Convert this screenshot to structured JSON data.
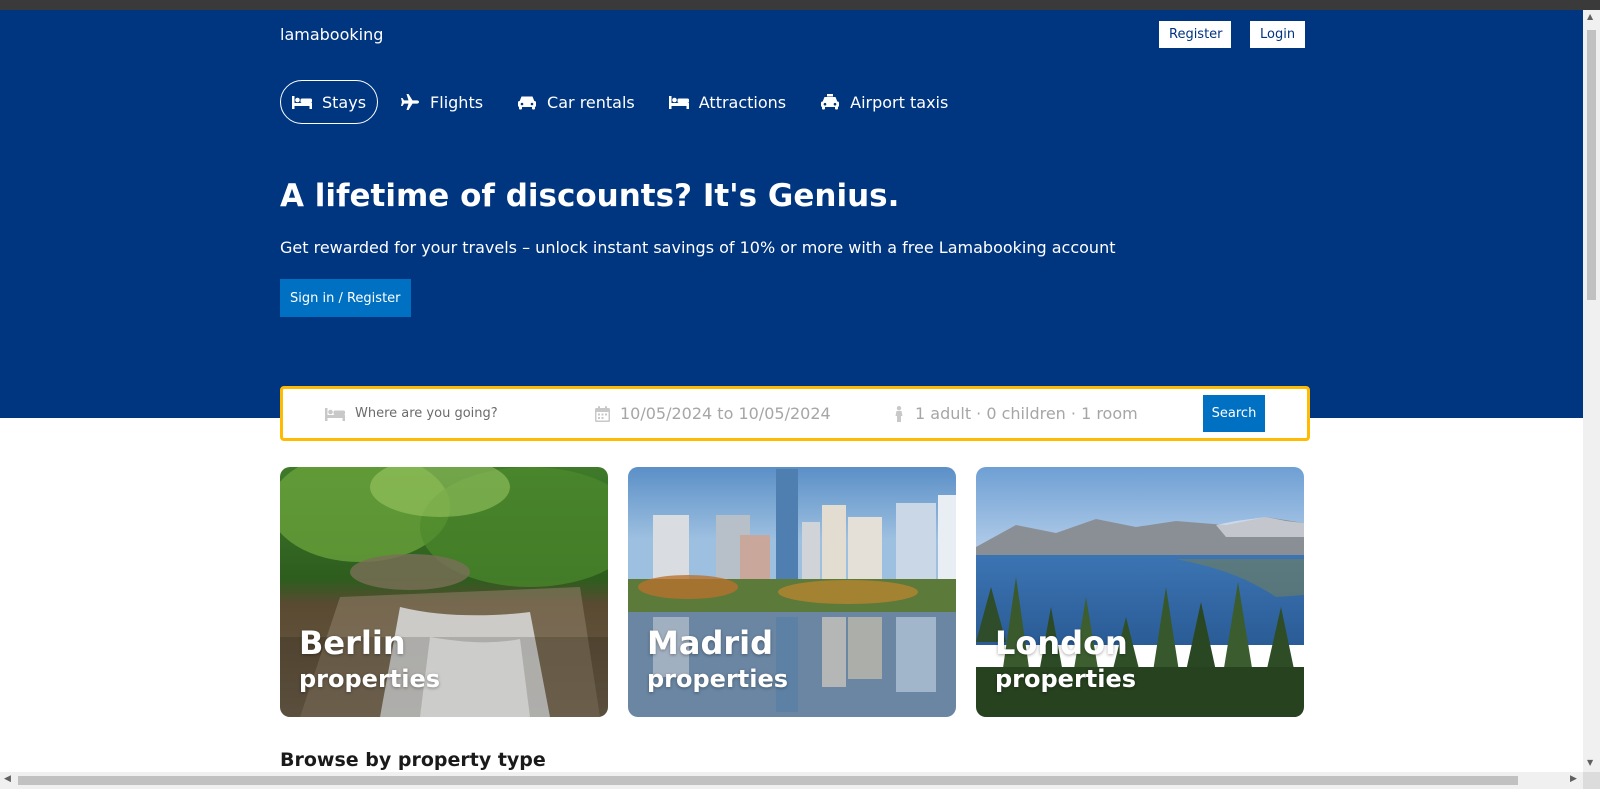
{
  "app": {
    "logo": "lamabooking"
  },
  "auth": {
    "register_label": "Register",
    "login_label": "Login"
  },
  "tabs": [
    {
      "label": "Stays",
      "icon": "bed-icon",
      "active": true
    },
    {
      "label": "Flights",
      "icon": "plane-icon",
      "active": false
    },
    {
      "label": "Car rentals",
      "icon": "car-icon",
      "active": false
    },
    {
      "label": "Attractions",
      "icon": "bed-icon",
      "active": false
    },
    {
      "label": "Airport taxis",
      "icon": "taxi-icon",
      "active": false
    }
  ],
  "hero": {
    "title": "A lifetime of discounts? It's Genius.",
    "subtitle": "Get rewarded for your travels – unlock instant savings of 10% or more with a free Lamabooking account",
    "cta_label": "Sign in / Register"
  },
  "search": {
    "destination_placeholder": "Where are you going?",
    "date_range": "10/05/2024 to 10/05/2024",
    "options": "1 adult · 0 children · 1 room",
    "button_label": "Search"
  },
  "featured": [
    {
      "city": "Berlin",
      "subtitle": "properties",
      "image": "waterfall-forest"
    },
    {
      "city": "Madrid",
      "subtitle": "properties",
      "image": "city-skyline-reflection"
    },
    {
      "city": "London",
      "subtitle": "properties",
      "image": "lake-mountains-forest"
    }
  ],
  "sections": {
    "browse_title": "Browse by property type"
  },
  "colors": {
    "header_bg": "#003580",
    "accent_blue": "#0071c2",
    "search_border": "#febb02"
  }
}
